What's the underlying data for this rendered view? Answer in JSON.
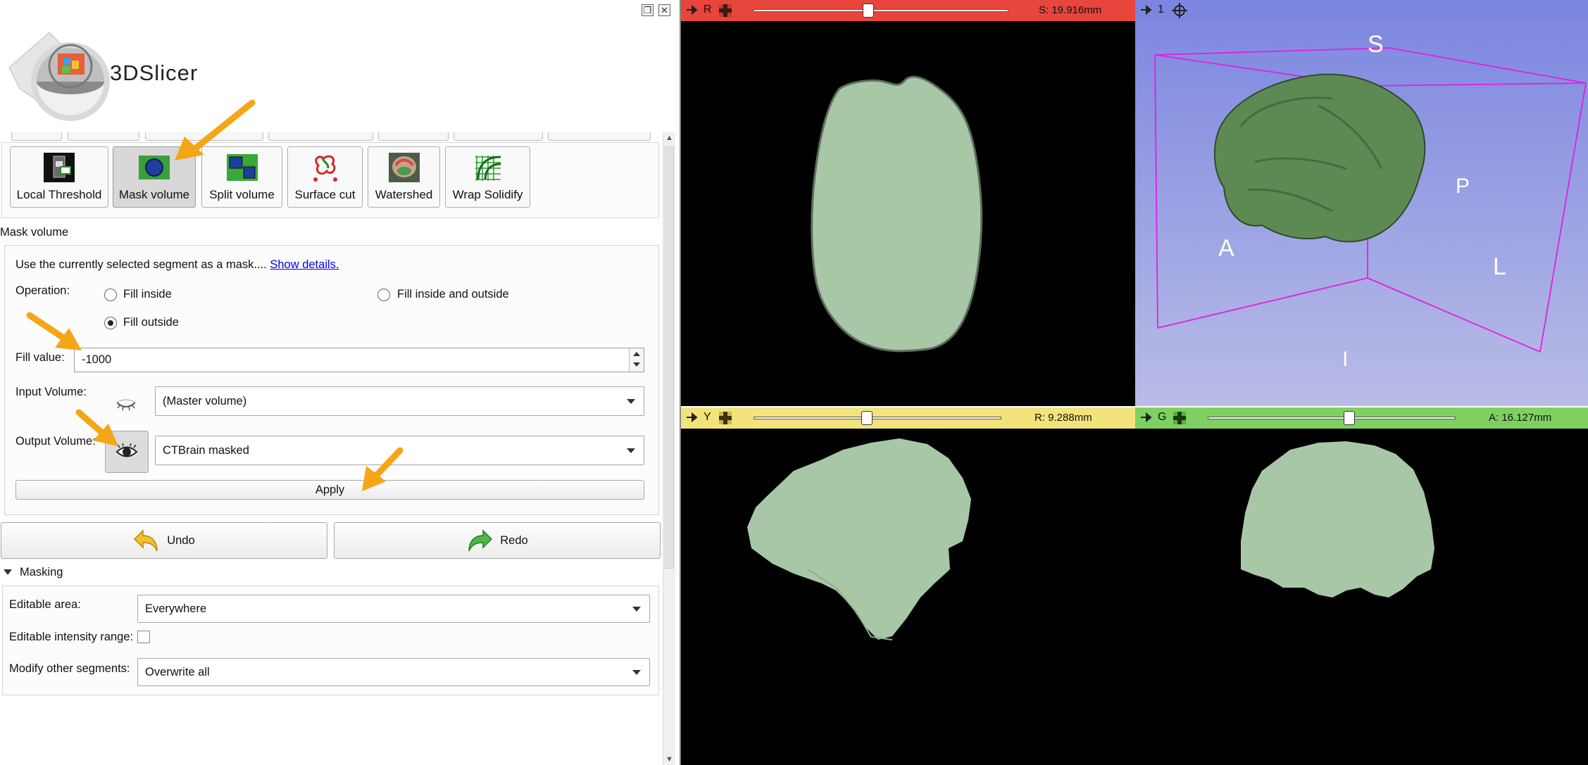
{
  "app": {
    "name": "3DSlicer"
  },
  "window": {
    "restore_icon": "restore-icon",
    "close_icon": "close-icon"
  },
  "effects": [
    {
      "label": "Local Threshold",
      "icon": "local-threshold-icon"
    },
    {
      "label": "Mask volume",
      "icon": "mask-volume-icon",
      "selected": true
    },
    {
      "label": "Split volume",
      "icon": "split-volume-icon"
    },
    {
      "label": "Surface cut",
      "icon": "surface-cut-icon"
    },
    {
      "label": "Watershed",
      "icon": "watershed-icon"
    },
    {
      "label": "Wrap Solidify",
      "icon": "wrap-solidify-icon"
    }
  ],
  "mask_volume": {
    "title": "Mask volume",
    "description": "Use the currently selected segment as a mask....",
    "show_details": "Show details.",
    "operation_label": "Operation:",
    "options": {
      "fill_inside": "Fill inside",
      "fill_inside_outside": "Fill inside and outside",
      "fill_outside": "Fill outside"
    },
    "selected_option": "Fill outside",
    "fill_value_label": "Fill value:",
    "fill_value": "-1000",
    "input_volume_label": "Input Volume:",
    "input_volume": "(Master volume)",
    "output_volume_label": "Output Volume:",
    "output_volume": "CTBrain masked",
    "apply": "Apply"
  },
  "history": {
    "undo": "Undo",
    "redo": "Redo"
  },
  "masking": {
    "title": "Masking",
    "editable_area_label": "Editable area:",
    "editable_area": "Everywhere",
    "intensity_range_label": "Editable intensity range:",
    "intensity_range_checked": false,
    "modify_other_label": "Modify other segments:",
    "modify_other": "Overwrite all"
  },
  "views": {
    "red": {
      "letter": "R",
      "position": "S: 19.916mm",
      "color": "#e8453c",
      "slider": 0.5
    },
    "three_d": {
      "letter": "1",
      "color": "#7b86e0",
      "orientation": {
        "S": "S",
        "A": "A",
        "L": "L",
        "I": "I",
        "P": "P"
      }
    },
    "yellow": {
      "letter": "Y",
      "position": "R: 9.288mm",
      "color": "#f2e47a",
      "slider": 0.5
    },
    "green": {
      "letter": "G",
      "position": "A: 16.127mm",
      "color": "#7ed161",
      "slider": 0.5
    }
  },
  "colors": {
    "segment": "#a8c7a6",
    "segment_3d": "#5d8a52",
    "annotation_arrow": "#f5a617",
    "bbox": "#e020e0"
  }
}
